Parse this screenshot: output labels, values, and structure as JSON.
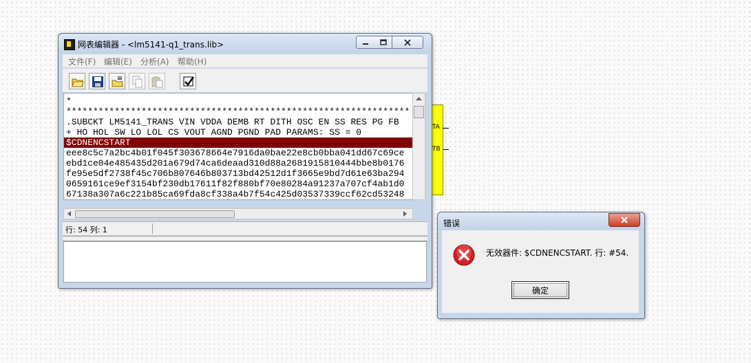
{
  "schematic": {
    "pins": [
      "TA",
      "TB"
    ]
  },
  "main_window": {
    "title": "网表编辑器 - <lm5141-q1_trans.lib>",
    "menu": [
      "文件(F)",
      "编辑(E)",
      "分析(A)",
      "帮助(H)"
    ],
    "toolbar": {
      "icons": [
        "open-folder-icon",
        "save-icon",
        "save-as-icon",
        "copy-icon",
        "paste-icon",
        "check-icon"
      ]
    },
    "editor_lines": [
      "*",
      "****************************************************************",
      ".SUBCKT LM5141_TRANS VIN VDDA DEMB RT DITH OSC EN SS RES PG FB",
      "+ HO HOL SW LO LOL CS VOUT AGND PGND PAD PARAMS: SS = 0",
      "$CDNENCSTART",
      "eee8c5c7a2bc4b01f045f303678664e7916da0bae22e8cb0bba041dd67c69ce",
      "ebd1ce04e485435d201a679d74ca6deaad310d88a2681915810444bbe8b0176",
      "fe95e5df2738f45c706b807646b803713bd42512d1f3665e9bd7d61e63ba294",
      "0659161ce9ef3154bf230db17611f82f880bf70e80284a91237a707cf4ab1d0",
      "67138a307a6c221b85ca69fda8cf338a4b7f54c425d03537339ccf62cd53248"
    ],
    "status": "行: 54 列: 1"
  },
  "error_dialog": {
    "title": "错误",
    "message": "无效器件: $CDNENCSTART. 行: #54.",
    "ok_label": "确定"
  }
}
